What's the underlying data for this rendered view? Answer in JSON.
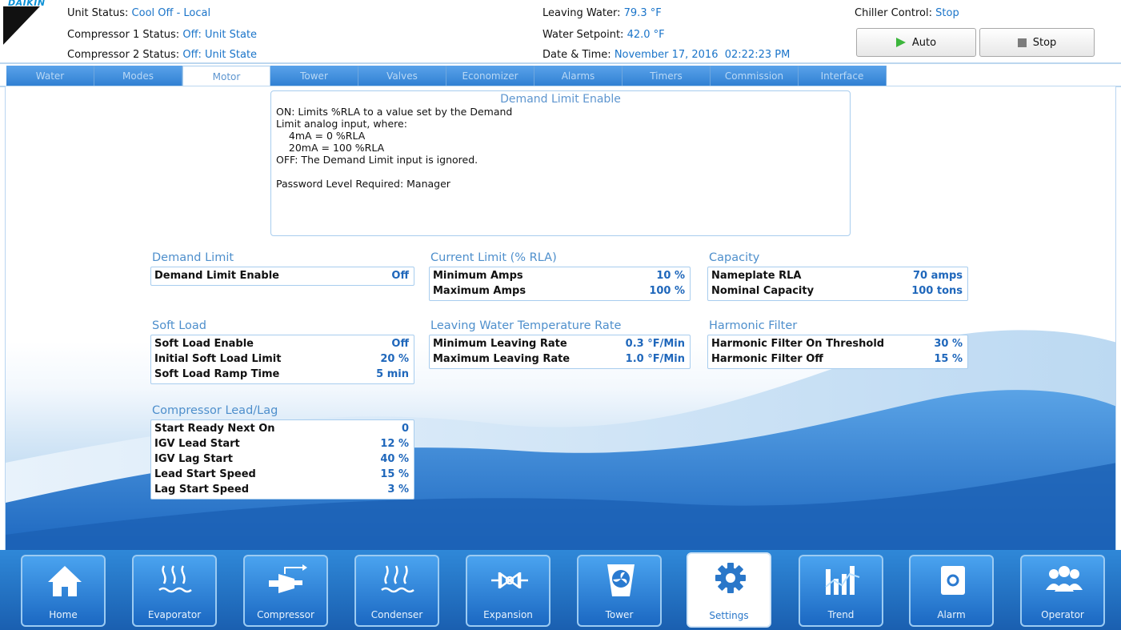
{
  "header": {
    "logo_text": "DAIKIN",
    "unit_status_label": "Unit Status:",
    "unit_status_value": "Cool Off - Local",
    "comp1_label": "Compressor 1 Status:",
    "comp1_value": "Off: Unit State",
    "comp2_label": "Compressor 2 Status:",
    "comp2_value": "Off: Unit State",
    "leaving_water_label": "Leaving Water:",
    "leaving_water_value": "79.3 °F",
    "water_setpoint_label": "Water Setpoint:",
    "water_setpoint_value": "42.0 °F",
    "datetime_label": "Date & Time:",
    "datetime_value": "November 17, 2016  02:22:23 PM",
    "chiller_control_label": "Chiller Control:",
    "chiller_control_value": "Stop",
    "auto_label": "Auto",
    "stop_label": "Stop"
  },
  "tabs": [
    "Water",
    "Modes",
    "Motor",
    "Tower",
    "Valves",
    "Economizer",
    "Alarms",
    "Timers",
    "Commission",
    "Interface"
  ],
  "active_tab": "Motor",
  "help": {
    "title": "Demand Limit Enable",
    "lines": [
      "ON: Limits %RLA to a value set by the Demand",
      "Limit analog input, where:",
      "    4mA = 0 %RLA",
      "    20mA = 100 %RLA",
      "OFF: The Demand Limit input is ignored.",
      "",
      "Password Level Required: Manager"
    ]
  },
  "groups": {
    "demand_limit": {
      "title": "Demand Limit",
      "rows": [
        {
          "label": "Demand Limit Enable",
          "value": "Off"
        }
      ]
    },
    "current_limit": {
      "title": "Current Limit (% RLA)",
      "rows": [
        {
          "label": "Minimum Amps",
          "value": "10 %"
        },
        {
          "label": "Maximum Amps",
          "value": "100 %"
        }
      ]
    },
    "capacity": {
      "title": "Capacity",
      "rows": [
        {
          "label": "Nameplate RLA",
          "value": "70 amps"
        },
        {
          "label": "Nominal Capacity",
          "value": "100 tons"
        }
      ]
    },
    "soft_load": {
      "title": "Soft Load",
      "rows": [
        {
          "label": "Soft Load Enable",
          "value": "Off"
        },
        {
          "label": "Initial Soft Load Limit",
          "value": "20 %"
        },
        {
          "label": "Soft Load Ramp Time",
          "value": "5 min"
        }
      ]
    },
    "lwt_rate": {
      "title": "Leaving Water Temperature Rate",
      "rows": [
        {
          "label": "Minimum Leaving Rate",
          "value": "0.3 °F/Min"
        },
        {
          "label": "Maximum Leaving Rate",
          "value": "1.0 °F/Min"
        }
      ]
    },
    "harmonic_filter": {
      "title": "Harmonic Filter",
      "rows": [
        {
          "label": "Harmonic Filter On Threshold",
          "value": "30 %"
        },
        {
          "label": "Harmonic Filter Off",
          "value": "15 %"
        }
      ]
    },
    "lead_lag": {
      "title": "Compressor Lead/Lag",
      "rows": [
        {
          "label": "Start Ready Next On",
          "value": "0"
        },
        {
          "label": "IGV Lead Start",
          "value": "12 %"
        },
        {
          "label": "IGV Lag Start",
          "value": "40 %"
        },
        {
          "label": "Lead Start Speed",
          "value": "15 %"
        },
        {
          "label": "Lag Start Speed",
          "value": "3 %"
        }
      ]
    }
  },
  "nav": [
    {
      "label": "Home",
      "icon": "home-icon"
    },
    {
      "label": "Evaporator",
      "icon": "evaporator-icon"
    },
    {
      "label": "Compressor",
      "icon": "compressor-icon"
    },
    {
      "label": "Condenser",
      "icon": "condenser-icon"
    },
    {
      "label": "Expansion",
      "icon": "expansion-valve-icon"
    },
    {
      "label": "Tower",
      "icon": "tower-fan-icon"
    },
    {
      "label": "Settings",
      "icon": "gear-icon"
    },
    {
      "label": "Trend",
      "icon": "trend-chart-icon"
    },
    {
      "label": "Alarm",
      "icon": "alarm-icon"
    },
    {
      "label": "Operator",
      "icon": "operators-icon"
    }
  ],
  "active_nav": "Settings",
  "colors": {
    "accent": "#1a74c9",
    "tab_bar": "#2f7fd2",
    "nav_bar": "#1a5fb0",
    "play_green": "#3cb63c"
  }
}
